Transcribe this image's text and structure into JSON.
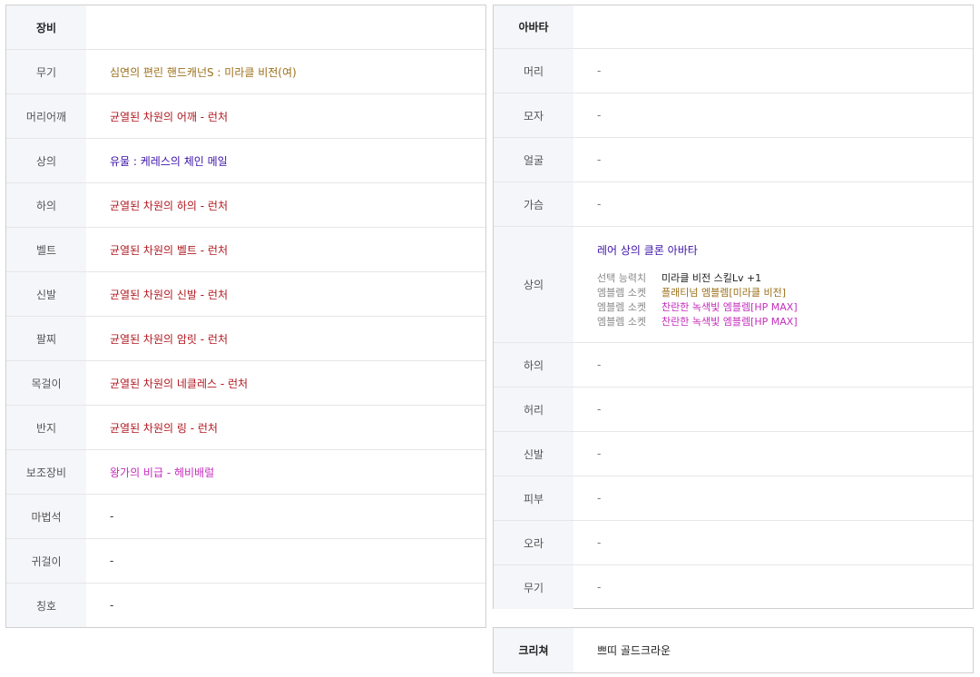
{
  "equipment": {
    "header": "장비",
    "rows": [
      {
        "slot": "무기",
        "item": "심연의 편린 핸드캐넌S : 미라클 비전(여)"
      },
      {
        "slot": "머리어깨",
        "item": "균열된 차원의 어깨 - 런처"
      },
      {
        "slot": "상의",
        "item": "유물 : 케레스의 체인 메일"
      },
      {
        "slot": "하의",
        "item": "균열된 차원의 하의 - 런처"
      },
      {
        "slot": "벨트",
        "item": "균열된 차원의 벨트 - 런처"
      },
      {
        "slot": "신발",
        "item": "균열된 차원의 신발 - 런처"
      },
      {
        "slot": "팔찌",
        "item": "균열된 차원의 암릿 - 런처"
      },
      {
        "slot": "목걸이",
        "item": "균열된 차원의 네클레스 - 런처"
      },
      {
        "slot": "반지",
        "item": "균열된 차원의 링 - 런처"
      },
      {
        "slot": "보조장비",
        "item": "왕가의 비급 - 헤비배럴"
      },
      {
        "slot": "마법석",
        "item": "-"
      },
      {
        "slot": "귀걸이",
        "item": "-"
      },
      {
        "slot": "칭호",
        "item": "-"
      }
    ]
  },
  "avatar": {
    "header": "아바타",
    "rows": [
      {
        "slot": "머리",
        "item": "-"
      },
      {
        "slot": "모자",
        "item": "-"
      },
      {
        "slot": "얼굴",
        "item": "-"
      },
      {
        "slot": "가슴",
        "item": "-"
      },
      {
        "slot": "상의",
        "item": "레어 상의 클론 아바타",
        "details": [
          {
            "key": "선택 능력치",
            "value": "미라클 비전 스킬Lv +1"
          },
          {
            "key": "엠블렘 소켓",
            "value": "플래티넘 엠블렘[미라클 비전]"
          },
          {
            "key": "엠블렘 소켓",
            "value": "찬란한 녹색빛 엠블렘[HP MAX]"
          },
          {
            "key": "엠블렘 소켓",
            "value": "찬란한 녹색빛 엠블렘[HP MAX]"
          }
        ]
      },
      {
        "slot": "하의",
        "item": "-"
      },
      {
        "slot": "허리",
        "item": "-"
      },
      {
        "slot": "신발",
        "item": "-"
      },
      {
        "slot": "피부",
        "item": "-"
      },
      {
        "slot": "오라",
        "item": "-"
      },
      {
        "slot": "무기",
        "item": "-"
      }
    ]
  },
  "creature": {
    "header": "크리쳐",
    "item": "쁘띠 골드크라운"
  },
  "colors": {
    "legendary": "#9b6f1a",
    "epic": "#b0171f",
    "relic": "#3c13a8",
    "unique": "#c52dbd",
    "label_bg": "#f5f6fa",
    "border": "#cfcfcf"
  }
}
